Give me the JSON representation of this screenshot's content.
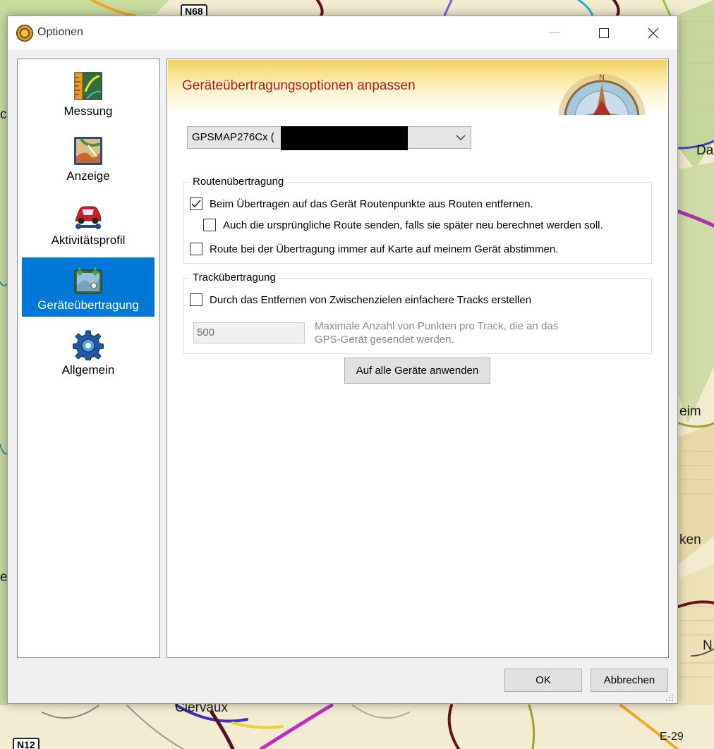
{
  "map": {
    "labels": [
      "Da",
      "eim",
      "ken",
      "N",
      "e",
      "c",
      "Clervaux",
      "E-29"
    ],
    "shields": [
      "N68",
      "N12"
    ]
  },
  "window": {
    "title": "Optionen",
    "icon": "gps-globe-icon"
  },
  "sidebar": {
    "items": [
      {
        "label": "Messung",
        "icon": "ruler-map-icon"
      },
      {
        "label": "Anzeige",
        "icon": "map-display-icon"
      },
      {
        "label": "Aktivitätsprofil",
        "icon": "car-wrench-icon"
      },
      {
        "label": "Geräteübertragung",
        "icon": "device-transfer-icon",
        "selected": true
      },
      {
        "label": "Allgemein",
        "icon": "gear-icon"
      }
    ]
  },
  "panel": {
    "banner_title": "Geräteübertragungsoptionen anpassen",
    "device_select_value": "GPSMAP276Cx (",
    "route_group": {
      "legend": "Routenübertragung",
      "options": [
        {
          "label": "Beim Übertragen auf das Gerät Routenpunkte aus Routen entfernen.",
          "checked": true
        },
        {
          "label": "Auch die ursprüngliche Route senden, falls sie später neu berechnet werden soll.",
          "checked": false
        },
        {
          "label": "Route bei der Übertragung immer auf Karte auf meinem Gerät abstimmen.",
          "checked": false
        }
      ]
    },
    "track_group": {
      "legend": "Trackübertragung",
      "option": {
        "label": "Durch das Entfernen von Zwischenzielen einfachere Tracks erstellen",
        "checked": false
      },
      "max_points_value": "500",
      "max_points_hint": "Maximale Anzahl von Punkten pro Track, die an das GPS-Gerät gesendet werden."
    },
    "apply_all_label": "Auf alle Geräte anwenden"
  },
  "footer": {
    "ok_label": "OK",
    "cancel_label": "Abbrechen"
  },
  "colors": {
    "selection": "#0078d7",
    "banner_title": "#b2182b"
  }
}
